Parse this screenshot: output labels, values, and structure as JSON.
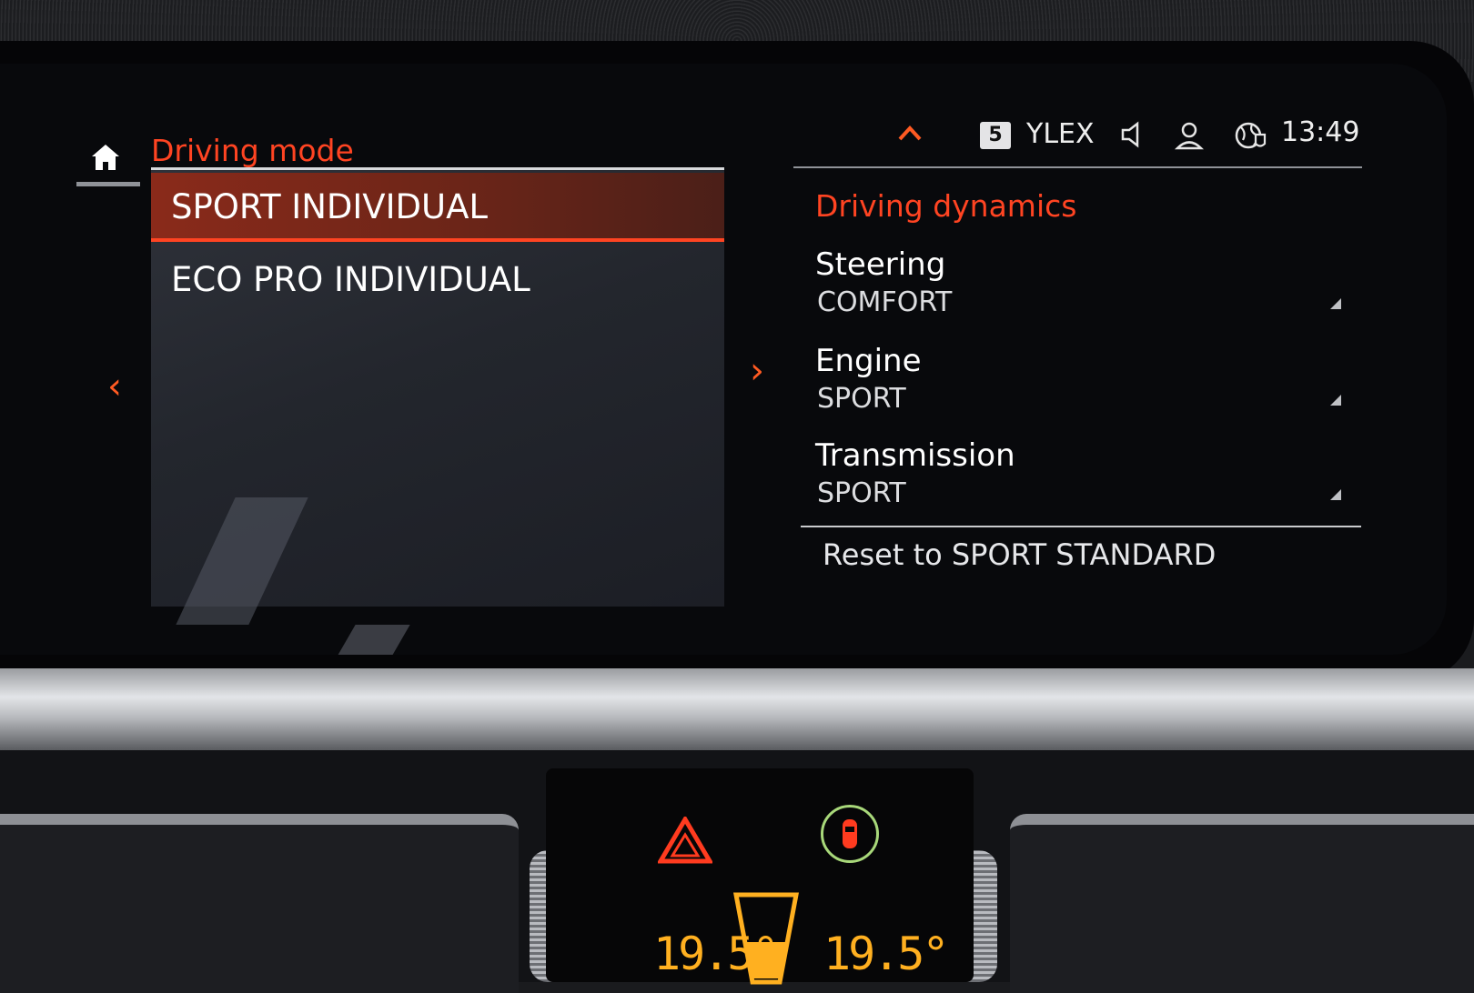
{
  "header": {
    "title": "Driving mode",
    "home_icon": "home-icon"
  },
  "status_bar": {
    "collapse_icon": "chevron-up-icon",
    "preset_number": "5",
    "station": "YLEX",
    "speaker_icon": "speaker-icon",
    "profile_icon": "profile-icon",
    "globe_icon": "globe-icon",
    "time": "13:49"
  },
  "modes": {
    "items": [
      {
        "label": "SPORT INDIVIDUAL",
        "selected": true
      },
      {
        "label": "ECO PRO INDIVIDUAL",
        "selected": false
      }
    ]
  },
  "navigation": {
    "left_icon": "chevron-left-icon",
    "right_icon": "chevron-right-icon"
  },
  "dynamics": {
    "title": "Driving dynamics",
    "settings": [
      {
        "label": "Steering",
        "value": "COMFORT"
      },
      {
        "label": "Engine",
        "value": "SPORT"
      },
      {
        "label": "Transmission",
        "value": "SPORT"
      }
    ],
    "reset_label": "Reset to SPORT STANDARD"
  },
  "climate": {
    "temp_left": "19.5°",
    "temp_right": "19.5°",
    "hazard_icon": "hazard-warning-icon",
    "seatbelt_icon": "seatbelt-warning-icon",
    "fan_icon": "fan-level-icon"
  },
  "colors": {
    "accent": "#ff4422",
    "selected_bg": "#7a2818",
    "climate_display": "#ffb020"
  }
}
